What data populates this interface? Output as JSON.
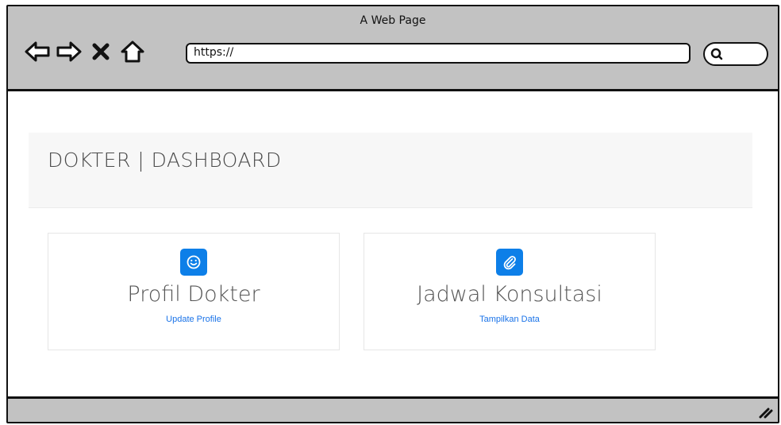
{
  "window": {
    "title": "A Web Page"
  },
  "toolbar": {
    "address": "https://",
    "icons": [
      "back-arrow-icon",
      "forward-arrow-icon",
      "close-x-icon",
      "home-icon",
      "search-icon"
    ]
  },
  "page": {
    "title": "DOKTER | DASHBOARD"
  },
  "cards": [
    {
      "title": "Profil Dokter",
      "link": "Update Profile",
      "icon": "smiley-icon"
    },
    {
      "title": "Jadwal Konsultasi",
      "link": "Tampilkan Data",
      "icon": "paperclip-icon"
    }
  ],
  "colors": {
    "chrome": "#c2c2c2",
    "accent": "#0d7fe8",
    "link": "#1a73e8",
    "header_band": "#f7f7f7"
  }
}
